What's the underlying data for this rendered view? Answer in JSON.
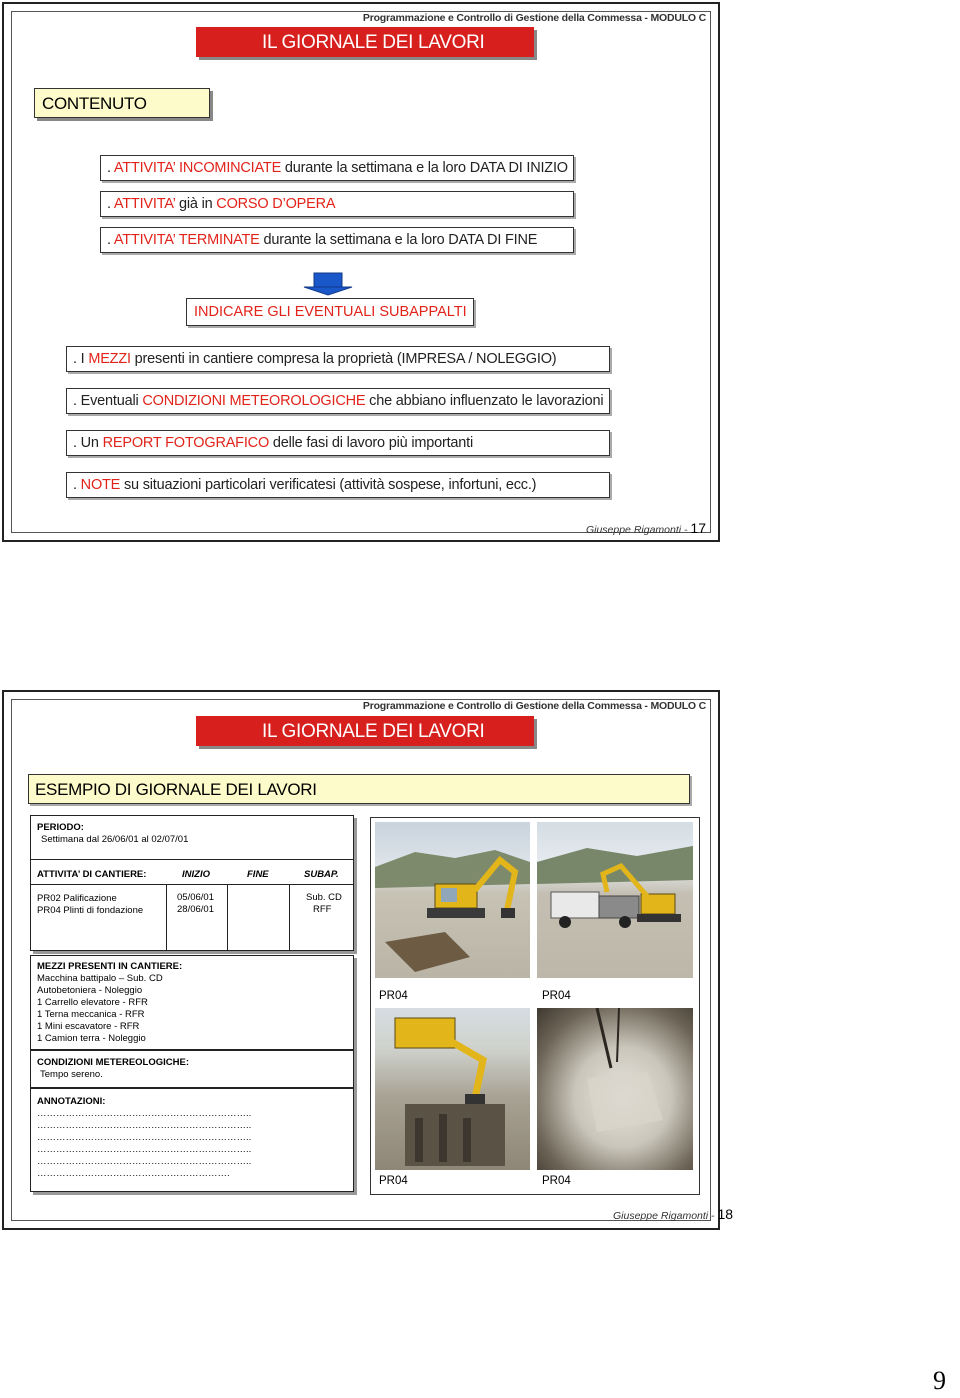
{
  "slide1": {
    "header": "Programmazione e Controllo di Gestione della Commessa - MODULO C",
    "title": "IL GIORNALE DEI LAVORI",
    "contenuto": "CONTENUTO",
    "items": [
      {
        "pre": ". ",
        "red": "ATTIVITA’ INCOMINCIATE",
        "post": " durante la settimana e la loro DATA DI INIZIO"
      },
      {
        "pre": ". ",
        "red": "ATTIVITA’",
        "mid": " già in ",
        "red2": "CORSO D’OPERA"
      },
      {
        "pre": ". ",
        "red": "ATTIVITA’ TERMINATE",
        "post": " durante la settimana e la loro DATA DI FINE"
      }
    ],
    "subappalti": "INDICARE GLI EVENTUALI SUBAPPALTI",
    "items2": [
      {
        "pre": ". I ",
        "red": "MEZZI",
        "post": " presenti in cantiere compresa la proprietà (IMPRESA / NOLEGGIO)"
      },
      {
        "pre": ". Eventuali ",
        "red": "CONDIZIONI METEOROLOGICHE",
        "post": " che abbiano influenzato le lavorazioni"
      },
      {
        "pre": ". Un ",
        "red": "REPORT FOTOGRAFICO",
        "post": " delle fasi di lavoro più importanti"
      },
      {
        "pre": ". ",
        "red": "NOTE",
        "post": " su situazioni particolari verificatesi (attività sospese, infortuni, ecc.)"
      }
    ],
    "footer_author": "Giuseppe Rigamonti - ",
    "footer_page": "17"
  },
  "slide2": {
    "header": "Programmazione e Controllo di Gestione della Commessa - MODULO C",
    "title": "IL GIORNALE DEI LAVORI",
    "esempio": "ESEMPIO DI GIORNALE DEI LAVORI",
    "periodo_label": "PERIODO:",
    "periodo_value": "Settimana dal 26/06/01 al 02/07/01",
    "attivita_label": "ATTIVITA’ DI CANTIERE:",
    "col_inizio": "INIZIO",
    "col_fine": "FINE",
    "col_subap": "SUBAP.",
    "rows": [
      {
        "name": "PR02 Palificazione",
        "inizio": "05/06/01",
        "subap": "Sub. CD"
      },
      {
        "name": "PR04  Plinti di fondazione",
        "inizio": "28/06/01",
        "subap": "RFF"
      }
    ],
    "mezzi_label": "MEZZI PRESENTI IN CANTIERE:",
    "mezzi": [
      "Macchina battipalo – Sub. CD",
      "Autobetoniera - Noleggio",
      "1 Carrello elevatore - RFR",
      "1 Terna meccanica - RFR",
      "1 Mini escavatore - RFR",
      "1 Camion terra - Noleggio"
    ],
    "condizioni_label": "CONDIZIONI METEREOLOGICHE:",
    "condizioni_value": "Tempo sereno.",
    "annotazioni_label": "ANNOTAZIONI:",
    "annotazioni_lines": [
      "…………………………………………………………..",
      "…………………………………………………………..",
      "…………………………………………………………..",
      "…………………………………………………………..",
      "…………………………………………………………..",
      "……………………………………………………."
    ],
    "photo_labels": [
      "PR04",
      "PR04",
      "PR04",
      "PR04"
    ],
    "footer_author": "Giuseppe Rigamonti - ",
    "footer_page": "18"
  },
  "page_number": "9"
}
